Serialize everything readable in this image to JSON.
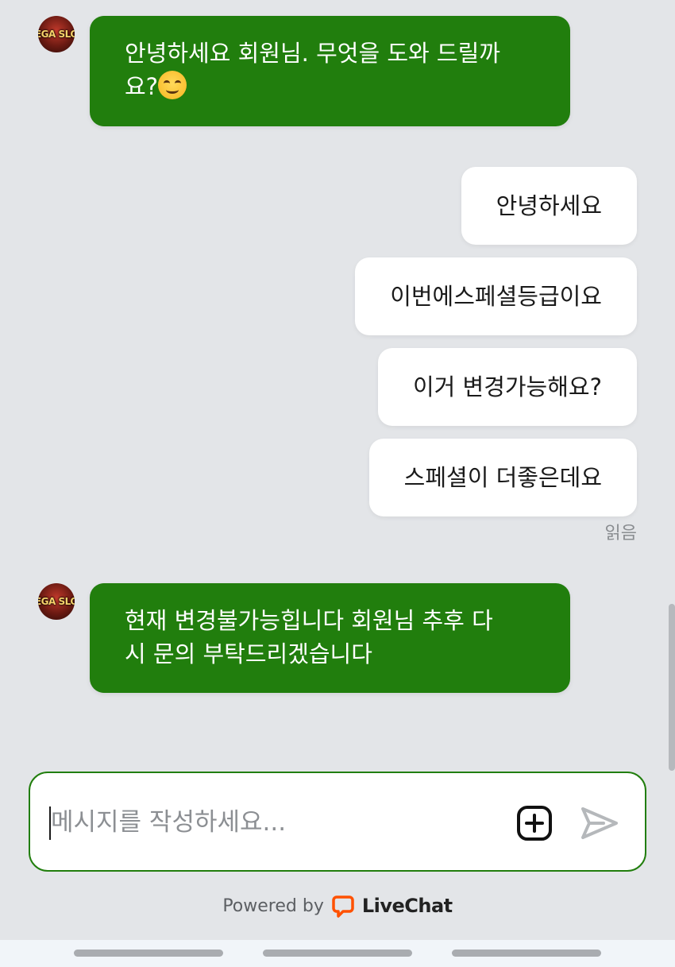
{
  "messages": [
    {
      "role": "agent",
      "avatar_text": "EGA SLO",
      "text_line1": "안녕하세요 회원님. 무엇을 도와 드릴까",
      "text_line2": "요?",
      "emoji": "smiling-face"
    },
    {
      "role": "user",
      "text": "안녕하세요"
    },
    {
      "role": "user",
      "text": "이번에스페셜등급이요"
    },
    {
      "role": "user",
      "text": "이거 변경가능해요?"
    },
    {
      "role": "user",
      "text": "스페셜이 더좋은데요"
    },
    {
      "role": "status",
      "text": "읽음"
    },
    {
      "role": "agent",
      "avatar_text": "EGA SLO",
      "text_line1": "현재 변경불가능힙니다 회원님 추후 다",
      "text_line2": "시 문의 부탁드리겠습니다"
    }
  ],
  "composer": {
    "placeholder": "메시지를 작성하세요...",
    "attach_icon": "plus-square-icon",
    "send_icon": "send-icon"
  },
  "footer": {
    "powered_by": "Powered by",
    "brand": "LiveChat",
    "brand_color": "#ff5100"
  },
  "colors": {
    "agent_bubble": "#217e0d",
    "user_bubble": "#ffffff",
    "background": "#e3e5e8"
  }
}
